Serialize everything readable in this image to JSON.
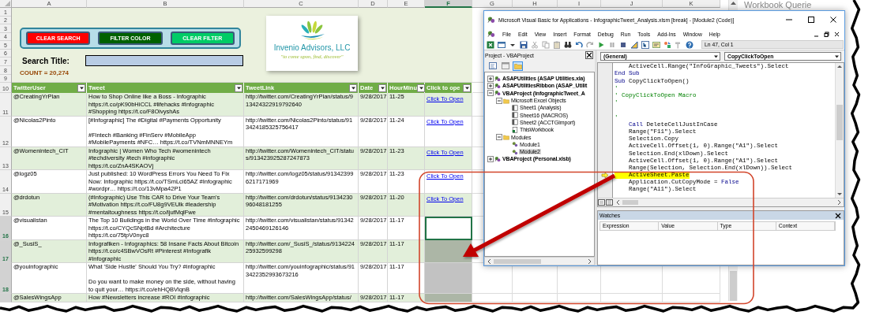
{
  "sheet": {
    "column_letters": [
      {
        "label": "A",
        "selected": false
      },
      {
        "label": "B",
        "selected": false
      },
      {
        "label": "C",
        "selected": false
      },
      {
        "label": "D",
        "selected": false
      },
      {
        "label": "E",
        "selected": false
      },
      {
        "label": "F",
        "selected": true
      },
      {
        "label": "G",
        "selected": false
      },
      {
        "label": "H",
        "selected": false
      },
      {
        "label": "I",
        "selected": false
      },
      {
        "label": "J",
        "selected": false
      },
      {
        "label": "K",
        "selected": false
      }
    ],
    "top_rows": [
      "1",
      "2",
      "3",
      "4",
      "5",
      "6",
      "7",
      "8",
      "9"
    ],
    "buttons": [
      {
        "label": "CLEAR SEARCH",
        "color": "#ff0000"
      },
      {
        "label": "FILTER COLOR",
        "color": "#006100"
      },
      {
        "label": "CLEAR FILTER",
        "color": "#00cc66"
      }
    ],
    "search": {
      "label": "Search Title:"
    },
    "count": "COUNT = 20,274",
    "logo": {
      "name": "Invenio Advisors, LLC",
      "tagline": "\"to come upon, find, discover\""
    },
    "table": {
      "header_row": "10",
      "columns": [
        "TwitterUser",
        "Tweet",
        "TweetLink",
        "Date",
        "HourMinu",
        "Click to ope"
      ],
      "rows": [
        {
          "number": "11",
          "user": "@CreatingYrPlan",
          "tweet": "How to Shop Online like a Boss - Infographic\nhttps://t.co/pK90bHiCCL #lifehacks #Infographic\n#Shopping https://t.co/F8OivyshAs",
          "link": "http://twitter.com/CreatingYrPlan/status/9\n13424322919792640",
          "date": "9/28/2017",
          "time": "11-25",
          "open": "Click To Open",
          "selected": false,
          "active": false
        },
        {
          "number": "12",
          "user": "@Nicolas2Pinto",
          "tweet": "[#Infographic] The #Digital #Payments Opportunity\n\n#Fintech #Banking #FinServ #MobileApp\n#MobilePayments #NFC… https://t.co/TVNmMNNEYm",
          "link": "http://twitter.com/Nicolas2Pinto/status/91\n3424185325756417",
          "date": "9/28/2017",
          "time": "11-24",
          "open": "Click To Open",
          "selected": false,
          "active": false
        },
        {
          "number": "13",
          "user": "@Womenintech_CIT",
          "tweet": "Infographic | Women Who Tech #womenintech\n#techdiversity #tech #infographic\nhttps://t.co/ZnA4SKAOVj",
          "link": "http://twitter.com/Womenintech_CIT/statu\ns/913423925287247873",
          "date": "9/28/2017",
          "time": "11-23",
          "open": "Click To Open",
          "selected": false,
          "active": false
        },
        {
          "number": "14",
          "user": "@logz05",
          "tweet": "Just published: 10 WordPress Errors You Need To Fix\nNow: Infographic https://t.co/TSmLci65AZ #Infographic\n#wordpr… https://t.co/13vMpa42P1",
          "link": "http://twitter.com/logz05/status/91342399\n6217171969",
          "date": "9/28/2017",
          "time": "11-23",
          "open": "Click To Open",
          "selected": false,
          "active": false
        },
        {
          "number": "15",
          "user": "@drdotun",
          "tweet": "(#Infographic) Use This CAR to Drive Your Team's\n#Motivation https://t.co/FU8g9VEUlk #leadership\n#mentaltoughness https://t.co/ljufMqlFwe",
          "link": "http://twitter.com/drdotun/status/9134230\n96048181255",
          "date": "9/28/2017",
          "time": "11-20",
          "open": "Click To Open",
          "selected": false,
          "active": false
        },
        {
          "number": "16",
          "user": "@visualistan",
          "tweet": "The Top 10 Buildings in the World Over Time #infographic\nhttps://t.co/CYQcSNptBd #Architecture\nhttps://t.co/75tpV0nyc8",
          "link": "http://twitter.com/visualistan/status/91342\n2450469126146",
          "date": "9/28/2017",
          "time": "11-17",
          "selected": true,
          "active": true
        },
        {
          "number": "17",
          "user": "@_SusiS_",
          "tweet": "Infografiken - Infographics: 58 Insane Facts About Bitcoin\nhttps://t.co/c4SBwVOsRt #Pinterest #Infografik\n#Infographic",
          "link": "http://twitter.com/_SusiS_/status/9134224\n25932599298",
          "date": "9/28/2017",
          "time": "11-17",
          "selected": true,
          "active": false
        },
        {
          "number": "18",
          "user": "@youinfographic",
          "tweet": "What 'Side Hustle' Should You Try? #infographic\n\nDo you want to make money on the side, without having\nto quit your… https://t.co/ehHQBVlqnB",
          "link": "http://twitter.com/youinfographic/status/91\n3422352993673216",
          "date": "9/28/2017",
          "time": "11-17",
          "selected": true,
          "active": false
        },
        {
          "user": "@SalesWingsApp",
          "tweet": "How #Newsletters increase #ROI #infographic",
          "link": "http://twitter.com/SalesWingsApp/status/",
          "date": "9/28/2017",
          "time": "11-17",
          "selected": true,
          "active": false
        }
      ]
    }
  },
  "side_panel": {
    "title": "Workbook Querie"
  },
  "vba": {
    "title": "Microsoft Visual Basic for Applications - InfographicTweet_Analysis.xlsm [break] - [Module2 (Code)]",
    "menu": [
      "File",
      "Edit",
      "View",
      "Insert",
      "Format",
      "Debug",
      "Run",
      "Tools",
      "Add-Ins",
      "Window",
      "Help"
    ],
    "position": "Ln 47, Col 1",
    "project": {
      "title": "Project - VBAProject",
      "tree": [
        {
          "label": "ASAPUtilities (ASAP Utilities.xla)",
          "kind": "project",
          "expanded": false,
          "selected": false
        },
        {
          "label": "ASAPUtilitiesRibbon (ASAP_Utilit",
          "kind": "project",
          "expanded": false,
          "selected": false
        },
        {
          "label": "VBAProject (InfographicTweet_A",
          "kind": "project",
          "expanded": true,
          "selected": false,
          "children": [
            {
              "label": "Microsoft Excel Objects",
              "kind": "folder",
              "expanded": true,
              "selected": false,
              "children": [
                {
                  "label": "Sheet1 (Analysis)",
                  "kind": "sheet",
                  "selected": false
                },
                {
                  "label": "Sheet16 (MACROS)",
                  "kind": "sheet",
                  "selected": false
                },
                {
                  "label": "Sheet2 (ACCTGImport)",
                  "kind": "sheet",
                  "selected": false
                },
                {
                  "label": "ThisWorkbook",
                  "kind": "workbook",
                  "selected": false
                }
              ]
            },
            {
              "label": "Modules",
              "kind": "folder",
              "expanded": true,
              "selected": false,
              "children": [
                {
                  "label": "Module1",
                  "kind": "module",
                  "selected": false
                },
                {
                  "label": "Module2",
                  "kind": "module",
                  "selected": true
                }
              ]
            }
          ]
        },
        {
          "label": "VBAProject (Personal.xlsb)",
          "kind": "project",
          "expanded": false,
          "selected": false
        }
      ]
    },
    "code": {
      "object": "(General)",
      "procedure": "CopyClickToOpen",
      "lines": [
        {
          "indented": true,
          "current": false,
          "tokens": [
            {
              "text": "ActiveCell.Range(\"InfoGraphic_Tweets\").Select",
              "kind": "plain"
            }
          ]
        },
        {
          "indented": false,
          "current": false,
          "tokens": [
            {
              "text": "End Sub",
              "kind": "keyword"
            }
          ]
        },
        {
          "indented": false,
          "current": false,
          "tokens": [
            {
              "text": "Sub",
              "kind": "keyword"
            },
            {
              "text": " CopyClickToOpen()",
              "kind": "plain"
            }
          ]
        },
        {
          "indented": false,
          "current": false,
          "tokens": [
            {
              "text": "'",
              "kind": "comment"
            }
          ]
        },
        {
          "indented": false,
          "current": false,
          "tokens": [
            {
              "text": "' CopyClickToOpen Macro",
              "kind": "comment"
            }
          ]
        },
        {
          "indented": false,
          "current": false,
          "tokens": [
            {
              "text": "'",
              "kind": "comment"
            }
          ]
        },
        {
          "current": false
        },
        {
          "indented": false,
          "current": false,
          "tokens": [
            {
              "text": "'",
              "kind": "comment"
            }
          ]
        },
        {
          "indented": true,
          "current": false,
          "tokens": [
            {
              "text": "Call",
              "kind": "keyword"
            },
            {
              "text": " DeleteCellJustInCase",
              "kind": "plain"
            }
          ]
        },
        {
          "indented": true,
          "current": false,
          "tokens": [
            {
              "text": "Range(\"F11\").Select",
              "kind": "plain"
            }
          ]
        },
        {
          "indented": true,
          "current": false,
          "tokens": [
            {
              "text": "Selection.Copy",
              "kind": "plain"
            }
          ]
        },
        {
          "indented": true,
          "current": false,
          "tokens": [
            {
              "text": "ActiveCell.Offset(1, 0).Range(\"A1\").Select",
              "kind": "plain"
            }
          ]
        },
        {
          "indented": true,
          "current": false,
          "tokens": [
            {
              "text": "Selection.End(xlDown).Select",
              "kind": "plain"
            }
          ]
        },
        {
          "indented": true,
          "current": false,
          "tokens": [
            {
              "text": "ActiveCell.Offset(1, 0).Range(\"A1\").Select",
              "kind": "plain"
            }
          ]
        },
        {
          "indented": true,
          "current": false,
          "tokens": [
            {
              "text": "Range(Selection, Selection.End(xlDown)).Select",
              "kind": "plain"
            }
          ]
        },
        {
          "indented": true,
          "current": true,
          "tokens": [
            {
              "text": "ActiveSheet.Paste",
              "kind": "plain"
            }
          ]
        },
        {
          "indented": true,
          "current": false,
          "tokens": [
            {
              "text": "Application.CutCopyMode = ",
              "kind": "plain"
            },
            {
              "text": "False",
              "kind": "keyword"
            }
          ]
        },
        {
          "indented": true,
          "current": false,
          "tokens": [
            {
              "text": "Range(\"A11\").Select",
              "kind": "plain"
            }
          ]
        }
      ]
    },
    "watches": {
      "title": "Watches",
      "columns": [
        "Expression",
        "Value",
        "Type",
        "Context"
      ]
    }
  }
}
